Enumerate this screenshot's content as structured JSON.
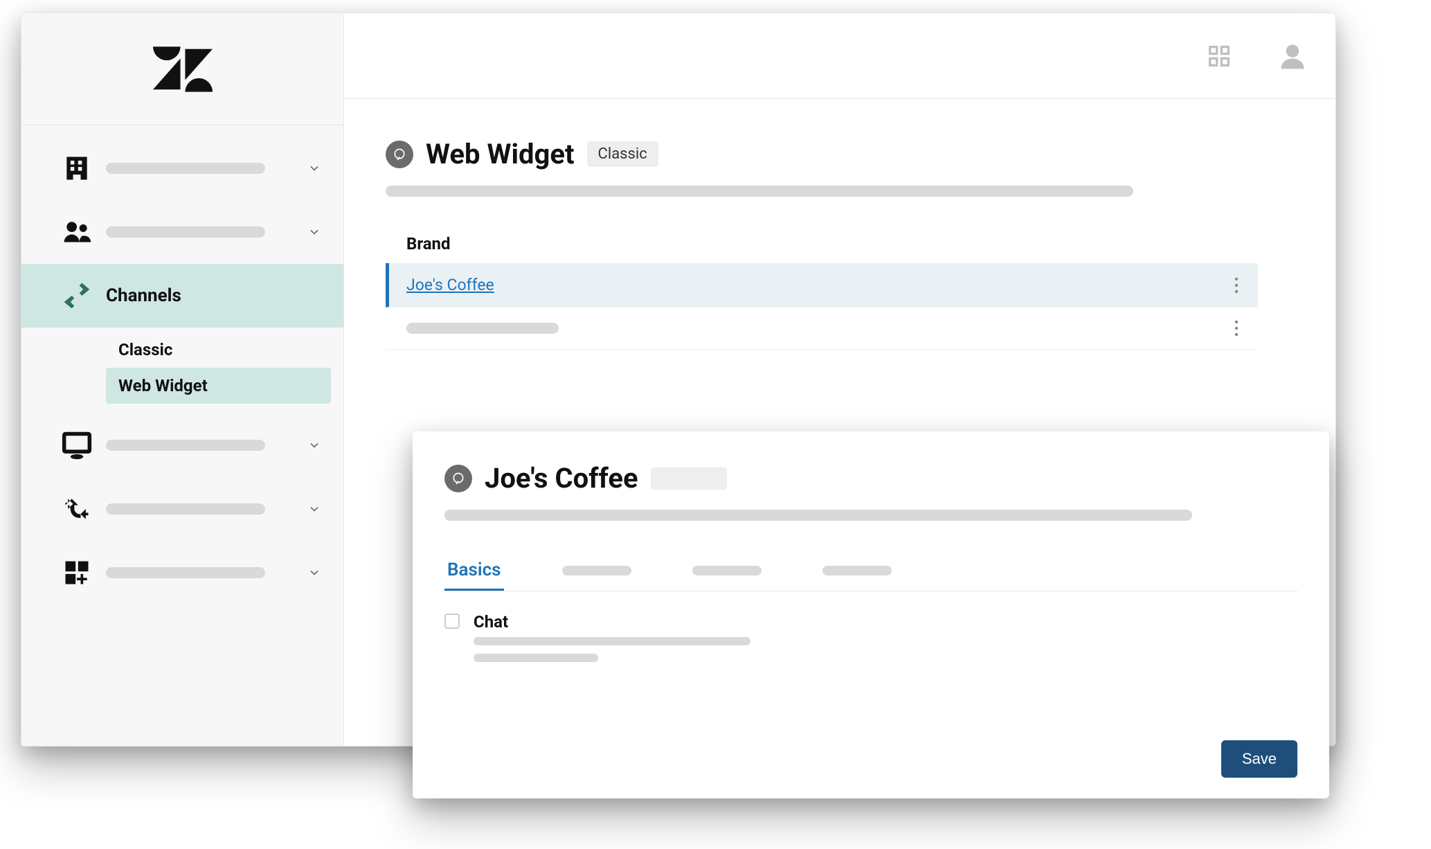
{
  "sidebar": {
    "channels_label": "Channels",
    "sub": {
      "classic": "Classic",
      "web_widget": "Web Widget"
    }
  },
  "page": {
    "title": "Web Widget",
    "badge": "Classic",
    "brand_section_label": "Brand",
    "brand_rows": {
      "selected_label": "Joe's Coffee"
    }
  },
  "detail": {
    "title": "Joe's Coffee",
    "tabs": {
      "basics": "Basics"
    },
    "option_label": "Chat",
    "save_label": "Save"
  }
}
